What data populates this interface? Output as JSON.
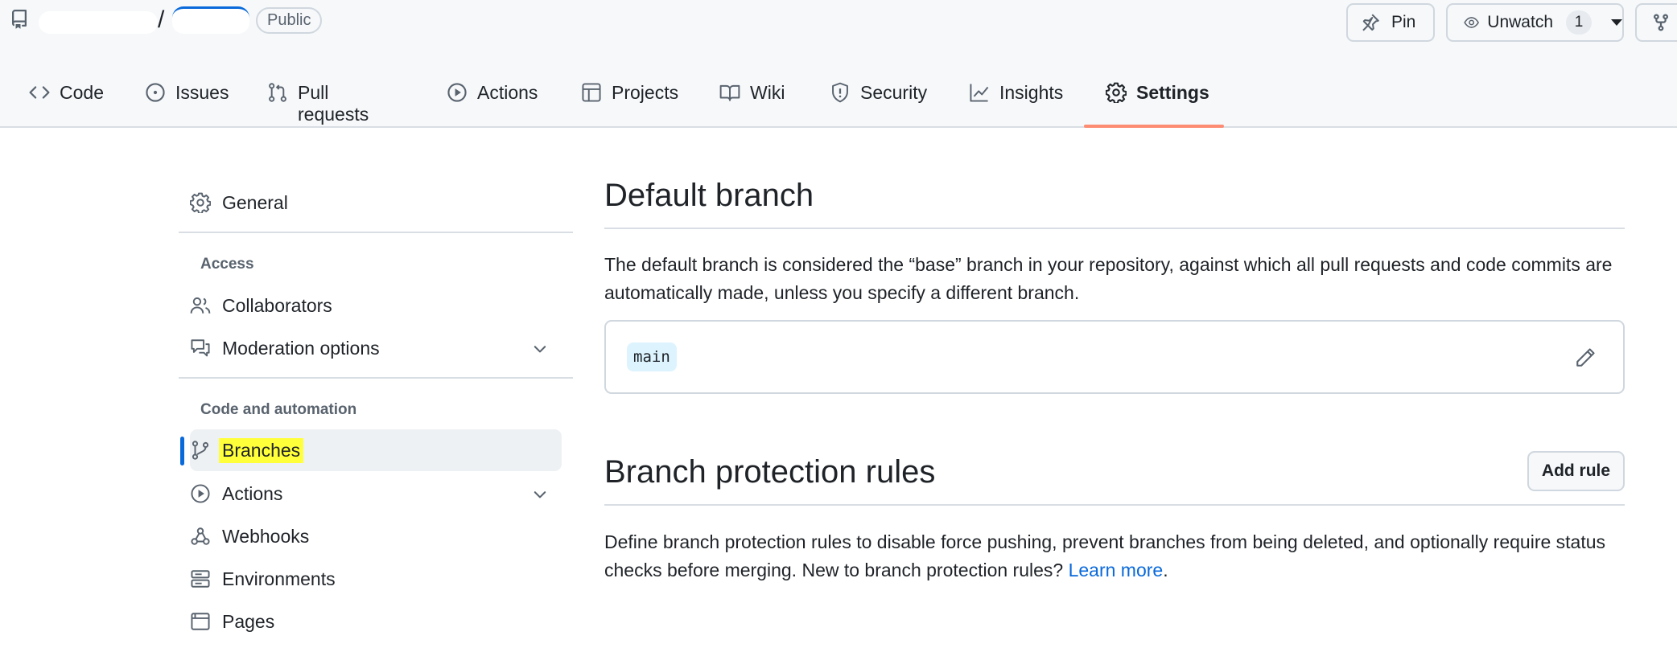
{
  "repo": {
    "separator": "/",
    "visibility": "Public",
    "pin_label": "Pin",
    "watch_label": "Unwatch",
    "watch_count": "1"
  },
  "tabs": [
    {
      "label": "Code",
      "icon": "code-icon"
    },
    {
      "label": "Issues",
      "icon": "issue-opened-icon"
    },
    {
      "label": "Pull requests",
      "icon": "git-pull-request-icon"
    },
    {
      "label": "Actions",
      "icon": "play-icon"
    },
    {
      "label": "Projects",
      "icon": "table-icon"
    },
    {
      "label": "Wiki",
      "icon": "book-icon"
    },
    {
      "label": "Security",
      "icon": "shield-icon"
    },
    {
      "label": "Insights",
      "icon": "graph-icon"
    },
    {
      "label": "Settings",
      "icon": "gear-icon",
      "selected": true
    }
  ],
  "sidebar": {
    "general": "General",
    "access_heading": "Access",
    "collaborators": "Collaborators",
    "moderation": "Moderation options",
    "code_heading": "Code and automation",
    "branches": "Branches",
    "actions": "Actions",
    "webhooks": "Webhooks",
    "environments": "Environments",
    "pages": "Pages"
  },
  "default_branch": {
    "title": "Default branch",
    "description": "The default branch is considered the “base” branch in your repository, against which all pull requests and code commits are automatically made, unless you specify a different branch.",
    "branch_name": "main"
  },
  "protection": {
    "title": "Branch protection rules",
    "add_rule": "Add rule",
    "description": "Define branch protection rules to disable force pushing, prevent branches from being deleted, and optionally require status checks before merging. New to branch protection rules?",
    "learn_more": "Learn more",
    "period": "."
  },
  "colors": {
    "accent": "#0969da",
    "tab_underline": "#fd8c73",
    "highlight": "#ffff3a",
    "header_bg": "#f6f8fa"
  }
}
